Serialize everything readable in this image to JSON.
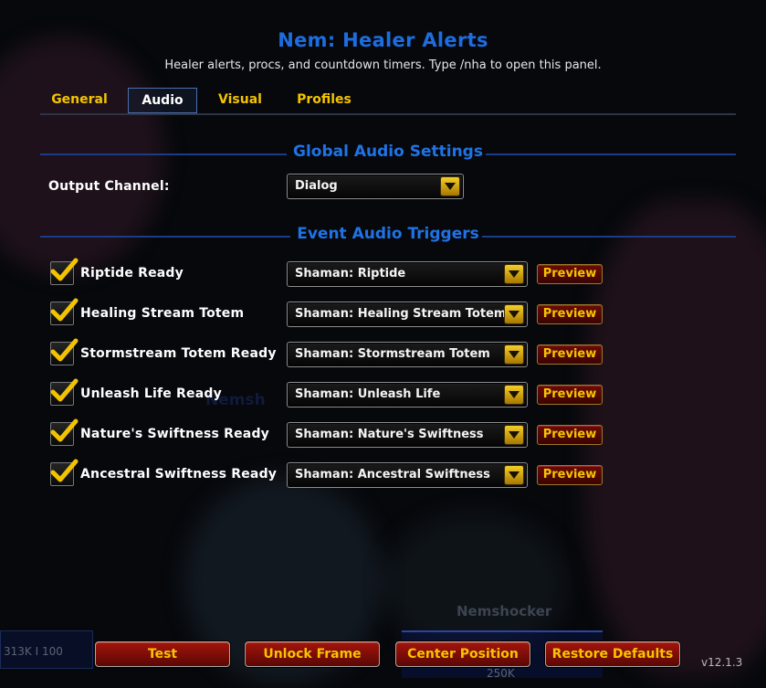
{
  "header": {
    "title": "Nem: Healer Alerts",
    "subtitle": "Healer alerts, procs, and countdown timers. Type /nha to open this panel."
  },
  "tabs": [
    {
      "label": "General"
    },
    {
      "label": "Audio"
    },
    {
      "label": "Visual"
    },
    {
      "label": "Profiles"
    }
  ],
  "active_tab": "Audio",
  "global_section": {
    "heading": "Global Audio Settings",
    "output_label": "Output Channel:",
    "output_value": "Dialog"
  },
  "events_section": {
    "heading": "Event Audio Triggers",
    "preview_label": "Preview",
    "rows": [
      {
        "label": "Riptide Ready",
        "sound": "Shaman: Riptide",
        "checked": true
      },
      {
        "label": "Healing Stream Totem",
        "sound": "Shaman: Healing Stream Totem",
        "checked": true
      },
      {
        "label": "Stormstream Totem Ready",
        "sound": "Shaman: Stormstream Totem",
        "checked": true
      },
      {
        "label": "Unleash Life Ready",
        "sound": "Shaman: Unleash Life",
        "checked": true
      },
      {
        "label": "Nature's Swiftness Ready",
        "sound": "Shaman: Nature's Swiftness",
        "checked": true
      },
      {
        "label": "Ancestral Swiftness Ready",
        "sound": "Shaman: Ancestral Swiftness",
        "checked": true
      }
    ]
  },
  "footer": {
    "test_label": "Test",
    "unlock_label": "Unlock Frame",
    "center_label": "Center Position",
    "restore_label": "Restore Defaults",
    "version": "v12.1.3"
  },
  "background": {
    "player_name": "Nemshocker",
    "player_name_ghost": "Nemsh",
    "hp_text": "313K I 100",
    "number_text": "250K"
  },
  "colors": {
    "title_blue": "#1d6de0",
    "tab_gold": "#f5c400",
    "button_red": "#8a0e08"
  }
}
